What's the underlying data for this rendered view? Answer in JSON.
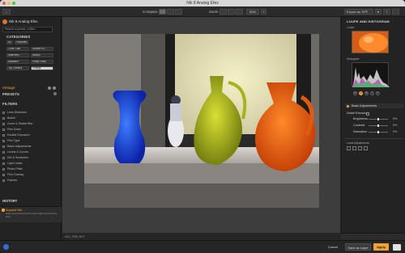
{
  "window": {
    "title": "Nik 8 Analog Efex"
  },
  "toolbar": {
    "compare_label": "Compare",
    "zoom_label": "Zoom",
    "zoom_value": "50%",
    "export_label": "Export as TIFF"
  },
  "left_panel": {
    "app_name": "Nik 8 Analog Efex",
    "search_placeholder": "Search a preset, a filter...",
    "categories_header": "CATEGORIES",
    "category_tabs": [
      "All",
      "Favorites"
    ],
    "categories": [
      [
        "Color Cast",
        "Double Ex..."
      ],
      [
        "Alternativ...",
        "Motion"
      ],
      [
        "Multilens",
        "Photo Plate"
      ],
      [
        "Toy Camera",
        "Vintage"
      ]
    ],
    "active_category": "Vintage",
    "presets_header": "PRESETS",
    "filters_header": "FILTERS",
    "filters": [
      "Lens Distortion",
      "Bokeh",
      "Zoom & Rotate Blur",
      "Film Grain",
      "Double Exposure",
      "Film Type",
      "Basic Adjustments",
      "Levels & Curves",
      "Dirt & Scratches",
      "Light Leaks",
      "Photo Plate",
      "Film Overlay",
      "Frames"
    ],
    "history_header": "HISTORY",
    "support_title": "Support Nik",
    "support_text": "Help us improve and we can support you at any time"
  },
  "canvas": {
    "caption": "IMG_9981.NEF"
  },
  "right_panel": {
    "header": "LOUPE AND HISTOGRAM",
    "loupe_label": "Loupe",
    "histogram_label": "Histogram",
    "channels": [
      "R",
      "G",
      "B",
      "L",
      "C"
    ],
    "basic_adjustments": "Basic Adjustments",
    "detail_extractor": "Detail Extractor",
    "sliders": [
      {
        "label": "Brightness",
        "value": "0%"
      },
      {
        "label": "Contrast",
        "value": "0%"
      },
      {
        "label": "Saturation",
        "value": "0%"
      }
    ],
    "local_adjustments": "Local Adjustments"
  },
  "bottom_bar": {
    "cancel": "Cancel",
    "save_as_layer": "Save as Layer",
    "apply": "Apply"
  },
  "colors": {
    "accent": "#f0a336",
    "panel": "#232323",
    "canvas_bg": "#3d3d3d"
  }
}
